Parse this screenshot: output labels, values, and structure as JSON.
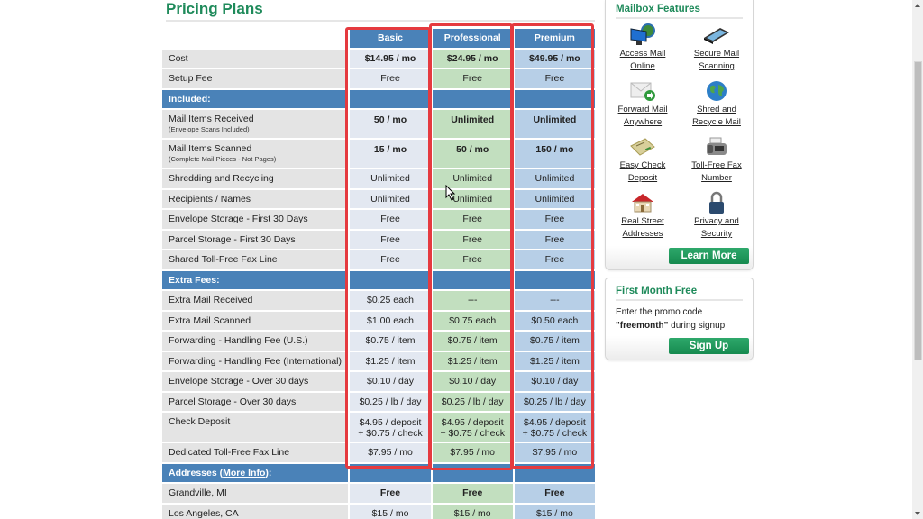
{
  "page_title": "Pricing Plans",
  "plans": [
    "Basic",
    "Professional",
    "Premium"
  ],
  "rows": {
    "cost": {
      "label": "Cost",
      "values": [
        "$14.95 / mo",
        "$24.95 / mo",
        "$49.95 / mo"
      ]
    },
    "setup_fee": {
      "label": "Setup Fee",
      "values": [
        "Free",
        "Free",
        "Free"
      ]
    },
    "included_header": "Included:",
    "mail_received": {
      "label": "Mail Items Received",
      "sub": "(Envelope Scans Included)",
      "values": [
        "50 / mo",
        "Unlimited",
        "Unlimited"
      ]
    },
    "mail_scanned": {
      "label": "Mail Items Scanned",
      "sub": "(Complete Mail Pieces - Not Pages)",
      "values": [
        "15 / mo",
        "50 / mo",
        "150 / mo"
      ]
    },
    "shredding": {
      "label": "Shredding and Recycling",
      "values": [
        "Unlimited",
        "Unlimited",
        "Unlimited"
      ]
    },
    "recipients": {
      "label": "Recipients / Names",
      "values": [
        "Unlimited",
        "Unlimited",
        "Unlimited"
      ]
    },
    "envelope_storage_30": {
      "label": "Envelope Storage - First 30 Days",
      "values": [
        "Free",
        "Free",
        "Free"
      ]
    },
    "parcel_storage_30": {
      "label": "Parcel Storage - First 30 Days",
      "values": [
        "Free",
        "Free",
        "Free"
      ]
    },
    "shared_fax": {
      "label": "Shared Toll-Free Fax Line",
      "values": [
        "Free",
        "Free",
        "Free"
      ]
    },
    "extra_fees_header": "Extra Fees:",
    "extra_received": {
      "label": "Extra Mail Received",
      "values": [
        "$0.25 each",
        "---",
        "---"
      ]
    },
    "extra_scanned": {
      "label": "Extra Mail Scanned",
      "values": [
        "$1.00 each",
        "$0.75 each",
        "$0.50 each"
      ]
    },
    "fwd_us": {
      "label": "Forwarding - Handling Fee (U.S.)",
      "values": [
        "$0.75 / item",
        "$0.75 / item",
        "$0.75 / item"
      ]
    },
    "fwd_intl": {
      "label": "Forwarding - Handling Fee (International)",
      "values": [
        "$1.25 / item",
        "$1.25 / item",
        "$1.25 / item"
      ]
    },
    "envelope_storage_over": {
      "label": "Envelope Storage - Over 30 days",
      "values": [
        "$0.10 / day",
        "$0.10 / day",
        "$0.10 / day"
      ]
    },
    "parcel_storage_over": {
      "label": "Parcel Storage - Over 30 days",
      "values": [
        "$0.25 / lb / day",
        "$0.25 / lb / day",
        "$0.25 / lb / day"
      ]
    },
    "check_deposit": {
      "label": "Check Deposit",
      "line1": "$4.95 / deposit",
      "line2": "+ $0.75 / check"
    },
    "dedicated_fax": {
      "label": "Dedicated Toll-Free Fax Line",
      "values": [
        "$7.95 / mo",
        "$7.95 / mo",
        "$7.95 / mo"
      ]
    },
    "addresses_header": {
      "prefix": "Addresses (",
      "link": "More Info",
      "suffix": "):"
    },
    "grandville": {
      "label": "Grandville, MI",
      "values": [
        "Free",
        "Free",
        "Free"
      ]
    },
    "los_angeles": {
      "label": "Los Angeles, CA",
      "values": [
        "$15 / mo",
        "$15 / mo",
        "$15 / mo"
      ]
    }
  },
  "sidebar": {
    "features_title": "Mailbox Features",
    "features": [
      {
        "icon": "monitor-globe-icon",
        "line1": "Access Mail",
        "line2": "Online"
      },
      {
        "icon": "scanner-icon",
        "line1": "Secure Mail",
        "line2": "Scanning"
      },
      {
        "icon": "envelope-forward-icon",
        "line1": "Forward Mail",
        "line2": "Anywhere"
      },
      {
        "icon": "globe-icon",
        "line1": "Shred and",
        "line2": "Recycle Mail"
      },
      {
        "icon": "check-icon",
        "line1": "Easy Check",
        "line2": "Deposit"
      },
      {
        "icon": "fax-machine-icon",
        "line1": "Toll-Free Fax",
        "line2": "Number"
      },
      {
        "icon": "house-icon",
        "line1": "Real Street",
        "line2": "Addresses"
      },
      {
        "icon": "padlock-icon",
        "line1": "Privacy and",
        "line2": "Security"
      }
    ],
    "learn_more": "Learn More",
    "promo_title": "First Month Free",
    "promo_line1": "Enter the promo code",
    "promo_code": "\"freemonth\"",
    "promo_line2_rest": " during signup",
    "sign_up": "Sign Up"
  },
  "colors": {
    "accent_green": "#1e8a5a",
    "header_blue": "#4a82b8",
    "basic_bg": "#e3e8f1",
    "pro_bg": "#c2dfbf",
    "premium_bg": "#b7cfe7",
    "highlight_red": "#e53a3f"
  }
}
